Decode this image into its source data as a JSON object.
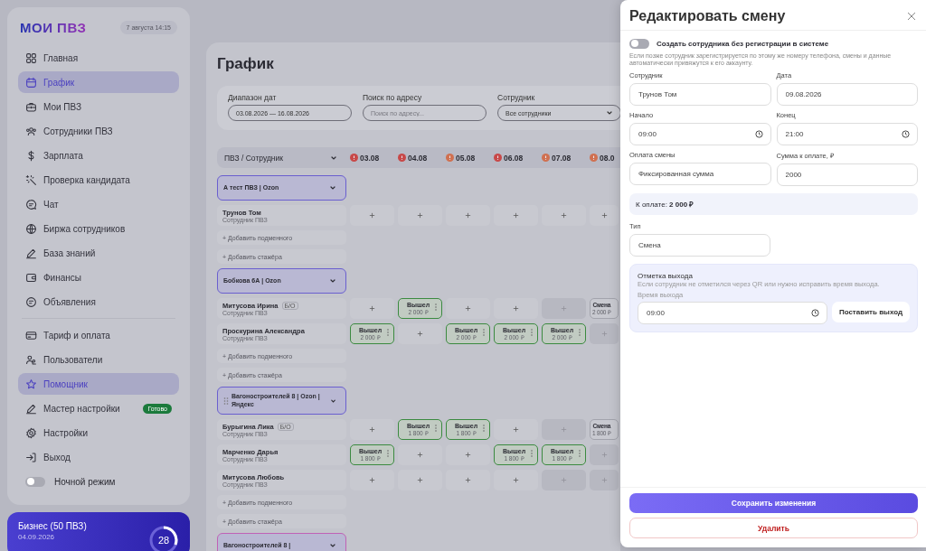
{
  "sidebar": {
    "logo": "МОИ ПВЗ",
    "datetime": "7 августа 14:15",
    "nav_main": [
      {
        "label": "Главная",
        "selected": false
      },
      {
        "label": "График",
        "selected": true
      },
      {
        "label": "Мои ПВЗ",
        "selected": false
      },
      {
        "label": "Сотрудники ПВЗ",
        "selected": false
      },
      {
        "label": "Зарплата",
        "selected": false
      },
      {
        "label": "Проверка кандидата",
        "selected": false
      },
      {
        "label": "Чат",
        "selected": false
      },
      {
        "label": "Биржа сотрудников",
        "selected": false
      },
      {
        "label": "База знаний",
        "selected": false
      },
      {
        "label": "Финансы",
        "selected": false
      },
      {
        "label": "Объявления",
        "selected": false
      }
    ],
    "nav_settings": [
      {
        "label": "Тариф и оплата",
        "selected": false
      },
      {
        "label": "Пользователи",
        "selected": false
      },
      {
        "label": "Помощник",
        "selected": true
      },
      {
        "label": "Мастер настройки",
        "selected": false,
        "badge": "Готово"
      },
      {
        "label": "Настройки",
        "selected": false
      },
      {
        "label": "Выход",
        "selected": false
      }
    ],
    "night_mode": {
      "label": "Ночной режим",
      "on": false
    }
  },
  "plan": {
    "name": "Бизнес (50 ПВЗ)",
    "date": "04.09.2026",
    "days": "28"
  },
  "schedule": {
    "title": "График",
    "filters": [
      {
        "kind": "text",
        "label": "Диапазон дат",
        "value": "03.08.2026 — 16.08.2026"
      },
      {
        "kind": "text",
        "label": "Поиск по адресу",
        "placeholder": "Поиск по адресу..."
      },
      {
        "kind": "select",
        "label": "Сотрудник",
        "value": "Все сотрудники"
      }
    ],
    "header": "ПВЗ / Сотрудник",
    "dates": [
      {
        "label": "03.08",
        "color": "#c84848"
      },
      {
        "label": "04.08",
        "color": "#c84848"
      },
      {
        "label": "05.08",
        "color": "#d07050"
      },
      {
        "label": "06.08",
        "color": "#c84848"
      },
      {
        "label": "07.08",
        "color": "#d07050"
      },
      {
        "label": "08.0",
        "color": "#d07050"
      }
    ],
    "groups": [
      {
        "name": "А тест ПВЗ | Ozon",
        "color": "#6a5fcf",
        "handle": false,
        "employees": [
          {
            "name": "Трунов Том",
            "role": "Сотрудник ПВЗ",
            "cells": [
              {
                "kind": "empty"
              },
              {
                "kind": "empty"
              },
              {
                "kind": "empty"
              },
              {
                "kind": "empty"
              },
              {
                "kind": "empty"
              },
              {
                "kind": "empty"
              }
            ]
          }
        ],
        "links": [
          "+ Добавить подменного",
          "+ Добавить стажёра"
        ]
      },
      {
        "name": "Бобкова 6А | Ozon",
        "color": "#6a5fcf",
        "handle": false,
        "employees": [
          {
            "name": "Митусова Ирина",
            "badge": "Б/О",
            "role": "Сотрудник ПВЗ",
            "cells": [
              {
                "kind": "empty"
              },
              {
                "kind": "worked",
                "status": "Вышел",
                "amount": "2 000 ₽"
              },
              {
                "kind": "empty"
              },
              {
                "kind": "empty"
              },
              {
                "kind": "disabled"
              },
              {
                "kind": "shift",
                "status": "Смена",
                "amount": "2 000 ₽"
              }
            ]
          },
          {
            "name": "Проскурина Александра",
            "role": "Сотрудник ПВЗ",
            "cells": [
              {
                "kind": "worked",
                "status": "Вышел",
                "amount": "2 000 ₽"
              },
              {
                "kind": "empty"
              },
              {
                "kind": "worked",
                "status": "Вышел",
                "amount": "2 000 ₽"
              },
              {
                "kind": "worked",
                "status": "Вышел",
                "amount": "2 000 ₽"
              },
              {
                "kind": "worked",
                "status": "Вышел",
                "amount": "2 000 ₽"
              },
              {
                "kind": "disabled"
              }
            ]
          }
        ],
        "links": [
          "+ Добавить подменного",
          "+ Добавить стажёра"
        ]
      },
      {
        "name": "Вагоностроителей 8 | Ozon | Яндекс",
        "color": "#6a5fcf",
        "handle": true,
        "employees": [
          {
            "name": "Бурыгина Лика",
            "badge": "Б/О",
            "role": "Сотрудник ПВЗ",
            "cells": [
              {
                "kind": "empty"
              },
              {
                "kind": "worked",
                "status": "Вышел",
                "amount": "1 800 ₽"
              },
              {
                "kind": "worked",
                "status": "Вышел",
                "amount": "1 800 ₽"
              },
              {
                "kind": "empty"
              },
              {
                "kind": "disabled"
              },
              {
                "kind": "shift",
                "status": "Смена",
                "amount": "1 800 ₽"
              }
            ]
          },
          {
            "name": "Марченко Дарья",
            "role": "Сотрудник ПВЗ",
            "cells": [
              {
                "kind": "worked",
                "status": "Вышел",
                "amount": "1 800 ₽"
              },
              {
                "kind": "empty"
              },
              {
                "kind": "empty"
              },
              {
                "kind": "worked",
                "status": "Вышел",
                "amount": "1 800 ₽"
              },
              {
                "kind": "worked",
                "status": "Вышел",
                "amount": "1 800 ₽"
              },
              {
                "kind": "disabled"
              }
            ]
          },
          {
            "name": "Митусова Любовь",
            "role": "Сотрудник ПВЗ",
            "cells": [
              {
                "kind": "empty"
              },
              {
                "kind": "empty"
              },
              {
                "kind": "empty"
              },
              {
                "kind": "empty"
              },
              {
                "kind": "disabled"
              },
              {
                "kind": "disabled"
              }
            ]
          }
        ],
        "links": [
          "+ Добавить подменного",
          "+ Добавить стажёра"
        ]
      },
      {
        "name": "Вагоностроителей 8 |",
        "color": "#c062b6",
        "handle": false
      }
    ]
  },
  "modal": {
    "title": "Редактировать смену",
    "toggle": {
      "label": "Создать сотрудника без регистрации в системе",
      "on": false
    },
    "note": "Если позже сотрудник зарегистрируется по этому же номеру телефона, смены и данные автоматически привяжутся к его аккаунту.",
    "fields": [
      {
        "kind": "text",
        "label": "Сотрудник",
        "value": "Трунов Том"
      },
      {
        "kind": "text",
        "label": "Дата",
        "value": "09.08.2026"
      },
      {
        "kind": "time",
        "label": "Начало",
        "value": "09:00"
      },
      {
        "kind": "time",
        "label": "Конец",
        "value": "21:00"
      },
      {
        "kind": "text",
        "label": "Оплата смены",
        "value": "Фиксированная сумма"
      },
      {
        "kind": "text",
        "label": "Сумма к оплате, ₽",
        "value": "2000"
      }
    ],
    "total": "К оплате: **2 000 ₽**",
    "type_field": {
      "label": "Тип",
      "value": "Смена"
    },
    "checkout": {
      "title": "Отметка выхода",
      "hint": "Если сотрудник не отметился через QR или нужно исправить время выхода.",
      "label": "Время выхода",
      "value": "09:00",
      "button": "Поставить выход"
    },
    "save": "Сохранить изменения",
    "delete": "Удалить"
  }
}
